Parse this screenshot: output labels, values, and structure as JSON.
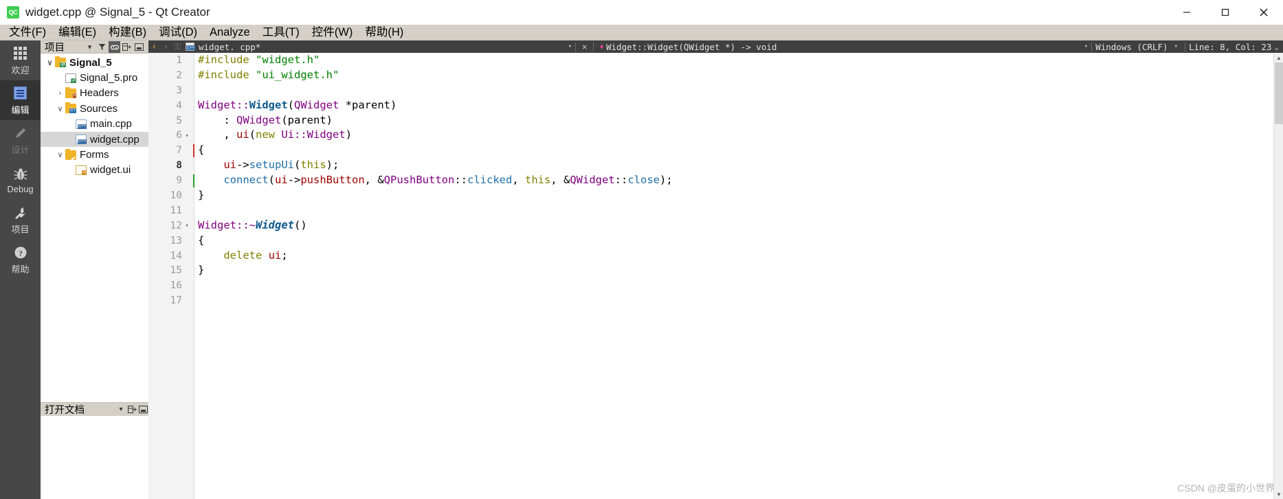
{
  "window": {
    "title": "widget.cpp @ Signal_5 - Qt Creator",
    "app_icon_label": "QC",
    "minimize_label": "—",
    "maximize_label": "□",
    "close_label": "✕"
  },
  "menubar": {
    "items": [
      {
        "label": "文件(F)"
      },
      {
        "label": "编辑(E)"
      },
      {
        "label": "构建(B)"
      },
      {
        "label": "调试(D)"
      },
      {
        "label": "Analyze"
      },
      {
        "label": "工具(T)"
      },
      {
        "label": "控件(W)"
      },
      {
        "label": "帮助(H)"
      }
    ]
  },
  "modebar": {
    "items": [
      {
        "label": "欢迎",
        "icon": "grid-icon",
        "state": "normal"
      },
      {
        "label": "编辑",
        "icon": "document-icon",
        "state": "active"
      },
      {
        "label": "设计",
        "icon": "pencil-icon",
        "state": "disabled"
      },
      {
        "label": "Debug",
        "icon": "bug-icon",
        "state": "normal"
      },
      {
        "label": "项目",
        "icon": "wrench-icon",
        "state": "normal"
      },
      {
        "label": "帮助",
        "icon": "question-icon",
        "state": "normal"
      }
    ]
  },
  "project_panel": {
    "header_title": "项目",
    "header_tools": [
      {
        "name": "chevron-down-icon",
        "glyph": "▾"
      },
      {
        "name": "filter-icon",
        "glyph": "᎒"
      },
      {
        "name": "link-icon",
        "glyph": "⚭"
      },
      {
        "name": "split-icon",
        "glyph": "⊞"
      },
      {
        "name": "minimize-panel-icon",
        "glyph": "▭"
      }
    ],
    "tree": [
      {
        "label": "Signal_5",
        "indent": 0,
        "chevron": "∨",
        "icon": "qt-project-folder-icon",
        "bold": true,
        "selected": false
      },
      {
        "label": "Signal_5.pro",
        "indent": 1,
        "chevron": "",
        "icon": "pro-file-icon",
        "bold": false,
        "selected": false
      },
      {
        "label": "Headers",
        "indent": 1,
        "chevron": "›",
        "icon": "headers-folder-icon",
        "bold": false,
        "selected": false
      },
      {
        "label": "Sources",
        "indent": 1,
        "chevron": "∨",
        "icon": "sources-folder-icon",
        "bold": false,
        "selected": false
      },
      {
        "label": "main.cpp",
        "indent": 2,
        "chevron": "",
        "icon": "cpp-file-icon",
        "bold": false,
        "selected": false
      },
      {
        "label": "widget.cpp",
        "indent": 2,
        "chevron": "",
        "icon": "cpp-file-icon",
        "bold": false,
        "selected": true
      },
      {
        "label": "Forms",
        "indent": 1,
        "chevron": "∨",
        "icon": "forms-folder-icon",
        "bold": false,
        "selected": false
      },
      {
        "label": "widget.ui",
        "indent": 2,
        "chevron": "",
        "icon": "ui-file-icon",
        "bold": false,
        "selected": false
      }
    ],
    "footer": {
      "label": "打开文档",
      "tools": [
        {
          "name": "chevron-down-icon",
          "glyph": "▾"
        },
        {
          "name": "split-icon",
          "glyph": "⊞"
        },
        {
          "name": "minimize-panel-icon",
          "glyph": "▭"
        }
      ]
    }
  },
  "editor_toolbar": {
    "back_glyph": "‹",
    "forward_glyph": "›",
    "lock_glyph": "⚿",
    "file_label": "widget. cpp*",
    "file_dropdown_glyph": "▾",
    "close_glyph": "✕",
    "symbol_marker_glyph": "♦",
    "symbol_label": "Widget::Widget(QWidget *) -> void",
    "symbol_dropdown_glyph": "▾",
    "line_ending": "Windows  (CRLF)",
    "encoding_dropdown_glyph": "▾",
    "cursor_position": "Line: 8, Col: 23",
    "expand_glyph": "⌄"
  },
  "editor": {
    "current_line": 8,
    "lines": [
      {
        "n": 1,
        "fold": "",
        "tokens": [
          {
            "t": "#include ",
            "c": "k-pp"
          },
          {
            "t": "\"widget.h\"",
            "c": "k-str"
          }
        ]
      },
      {
        "n": 2,
        "fold": "",
        "tokens": [
          {
            "t": "#include ",
            "c": "k-pp"
          },
          {
            "t": "\"ui_widget.h\"",
            "c": "k-str"
          }
        ]
      },
      {
        "n": 3,
        "fold": "",
        "tokens": []
      },
      {
        "n": 4,
        "fold": "",
        "tokens": [
          {
            "t": "Widget",
            "c": "k-type"
          },
          {
            "t": "::",
            "c": "k-type"
          },
          {
            "t": "Widget",
            "c": "k-fn"
          },
          {
            "t": "(",
            "c": "k-plain"
          },
          {
            "t": "QWidget",
            "c": "k-type"
          },
          {
            "t": " *parent)",
            "c": "k-plain"
          }
        ]
      },
      {
        "n": 5,
        "fold": "",
        "tokens": [
          {
            "t": "    : ",
            "c": "k-plain"
          },
          {
            "t": "QWidget",
            "c": "k-type"
          },
          {
            "t": "(parent)",
            "c": "k-plain"
          }
        ]
      },
      {
        "n": 6,
        "fold": "▾",
        "tokens": [
          {
            "t": "    , ",
            "c": "k-plain"
          },
          {
            "t": "ui",
            "c": "k-member"
          },
          {
            "t": "(",
            "c": "k-plain"
          },
          {
            "t": "new",
            "c": "k-kw"
          },
          {
            "t": " ",
            "c": "k-plain"
          },
          {
            "t": "Ui::Widget",
            "c": "k-type"
          },
          {
            "t": ")",
            "c": "k-plain"
          }
        ]
      },
      {
        "n": 7,
        "fold": "",
        "tokens": [
          {
            "t": "{",
            "c": "k-plain"
          }
        ]
      },
      {
        "n": 8,
        "fold": "",
        "tokens": [
          {
            "t": "    ",
            "c": "k-plain"
          },
          {
            "t": "ui",
            "c": "k-member"
          },
          {
            "t": "->",
            "c": "k-plain"
          },
          {
            "t": "setupUi",
            "c": "k-call"
          },
          {
            "t": "(",
            "c": "k-plain"
          },
          {
            "t": "this",
            "c": "k-this"
          },
          {
            "t": ");",
            "c": "k-plain"
          }
        ]
      },
      {
        "n": 9,
        "fold": "",
        "tokens": [
          {
            "t": "    ",
            "c": "k-plain"
          },
          {
            "t": "connect",
            "c": "k-call"
          },
          {
            "t": "(",
            "c": "k-plain"
          },
          {
            "t": "ui",
            "c": "k-member"
          },
          {
            "t": "->",
            "c": "k-plain"
          },
          {
            "t": "pushButton",
            "c": "k-member"
          },
          {
            "t": ", &",
            "c": "k-plain"
          },
          {
            "t": "QPushButton",
            "c": "k-type"
          },
          {
            "t": "::",
            "c": "k-plain"
          },
          {
            "t": "clicked",
            "c": "k-call"
          },
          {
            "t": ", ",
            "c": "k-plain"
          },
          {
            "t": "this",
            "c": "k-this"
          },
          {
            "t": ", &",
            "c": "k-plain"
          },
          {
            "t": "QWidget",
            "c": "k-type"
          },
          {
            "t": "::",
            "c": "k-plain"
          },
          {
            "t": "close",
            "c": "k-call"
          },
          {
            "t": ");",
            "c": "k-plain"
          }
        ]
      },
      {
        "n": 10,
        "fold": "",
        "tokens": [
          {
            "t": "}",
            "c": "k-plain"
          }
        ]
      },
      {
        "n": 11,
        "fold": "",
        "tokens": []
      },
      {
        "n": 12,
        "fold": "▾",
        "tokens": [
          {
            "t": "Widget",
            "c": "k-type"
          },
          {
            "t": "::~",
            "c": "k-type"
          },
          {
            "t": "Widget",
            "c": "k-fn-it"
          },
          {
            "t": "()",
            "c": "k-plain"
          }
        ]
      },
      {
        "n": 13,
        "fold": "",
        "tokens": [
          {
            "t": "{",
            "c": "k-plain"
          }
        ]
      },
      {
        "n": 14,
        "fold": "",
        "tokens": [
          {
            "t": "    ",
            "c": "k-plain"
          },
          {
            "t": "delete",
            "c": "k-kw"
          },
          {
            "t": " ",
            "c": "k-plain"
          },
          {
            "t": "ui",
            "c": "k-member"
          },
          {
            "t": ";",
            "c": "k-plain"
          }
        ]
      },
      {
        "n": 15,
        "fold": "",
        "tokens": [
          {
            "t": "}",
            "c": "k-plain"
          }
        ]
      },
      {
        "n": 16,
        "fold": "",
        "tokens": []
      },
      {
        "n": 17,
        "fold": "",
        "tokens": []
      }
    ]
  },
  "watermark": {
    "text": "CSDN @皮蛋的小世界"
  },
  "colors": {
    "accent_green": "#41cd52",
    "menubar_bg": "#d4d0c8",
    "modebar_bg": "#474747",
    "modebar_active_bg": "#333333",
    "toolbar_bg": "#3f3f3f",
    "selection_bg": "#d6d6d6",
    "gutter_bg": "#f3f3f3"
  }
}
